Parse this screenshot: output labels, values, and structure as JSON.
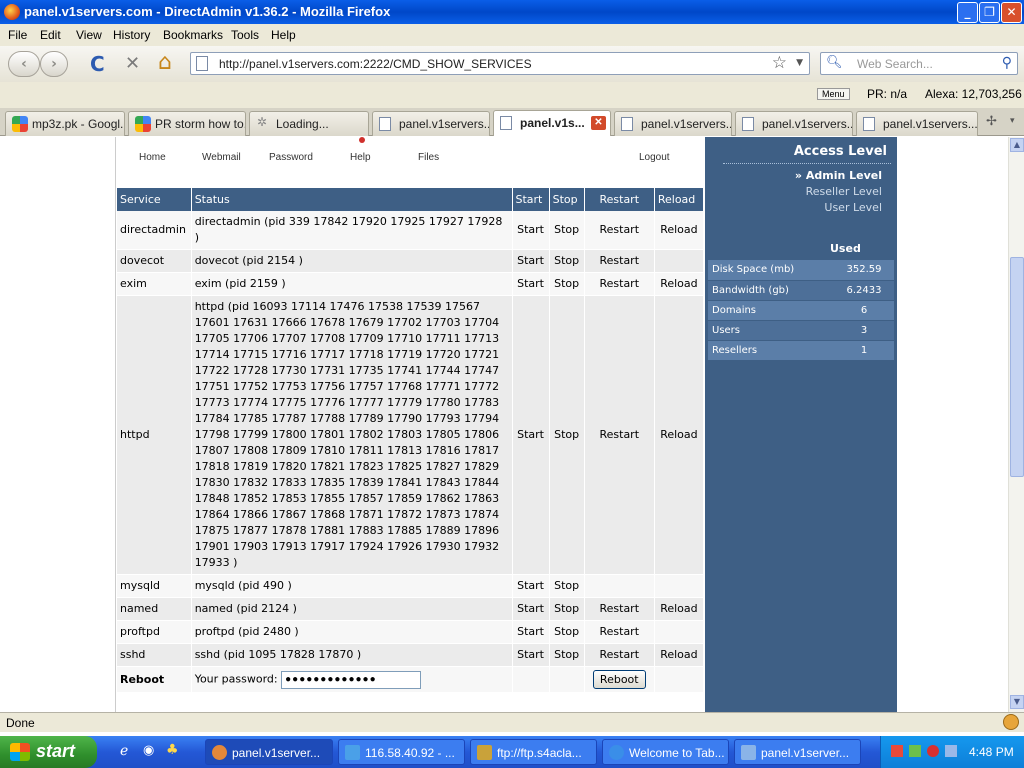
{
  "window": {
    "title": "panel.v1servers.com - DirectAdmin v1.36.2 - Mozilla Firefox",
    "minimize": "_",
    "maximize": "❐",
    "close": "✕"
  },
  "menu": [
    "File",
    "Edit",
    "View",
    "History",
    "Bookmarks",
    "Tools",
    "Help"
  ],
  "nav": {
    "url": "http://panel.v1servers.com:2222/CMD_SHOW_SERVICES",
    "search_placeholder": "Web Search...",
    "back": "‹",
    "forward": "›",
    "reload": "C",
    "stop": "✕",
    "home": "⌂",
    "star": "☆"
  },
  "statusline": {
    "menu": "Menu",
    "pr": "PR: n/a",
    "alexa": "Alexa: 12,703,256"
  },
  "tabs": [
    "mp3z.pk - Googl...",
    "PR storm how to...",
    "Loading...",
    "panel.v1servers...",
    "panel.v1s...",
    "panel.v1servers...",
    "panel.v1servers...",
    "panel.v1servers..."
  ],
  "toolbar_icons": [
    "Home",
    "Webmail",
    "Password",
    "Help",
    "Files",
    "Logout"
  ],
  "services": {
    "headers": [
      "Service",
      "Status",
      "Start",
      "Stop",
      "Restart",
      "Reload"
    ],
    "rows": [
      {
        "service": "directadmin",
        "status": "directadmin (pid 339 17842 17920 17925 17927 17928 )",
        "start": "Start",
        "stop": "Stop",
        "restart": "Restart",
        "reload": "Reload"
      },
      {
        "service": "dovecot",
        "status": "dovecot (pid 2154 )",
        "start": "Start",
        "stop": "Stop",
        "restart": "Restart",
        "reload": ""
      },
      {
        "service": "exim",
        "status": "exim (pid 2159 )",
        "start": "Start",
        "stop": "Stop",
        "restart": "Restart",
        "reload": "Reload"
      },
      {
        "service": "httpd",
        "status": "httpd (pid 16093 17114 17476 17538 17539 17567 17601 17631 17666 17678 17679 17702 17703 17704 17705 17706 17707 17708 17709 17710 17711 17713 17714 17715 17716 17717 17718 17719 17720 17721 17722 17728 17730 17731 17735 17741 17744 17747 17751 17752 17753 17756 17757 17768 17771 17772 17773 17774 17775 17776 17777 17779 17780 17783 17784 17785 17787 17788 17789 17790 17793 17794 17798 17799 17800 17801 17802 17803 17805 17806 17807 17808 17809 17810 17811 17813 17816 17817 17818 17819 17820 17821 17823 17825 17827 17829 17830 17832 17833 17835 17839 17841 17843 17844 17848 17852 17853 17855 17857 17859 17862 17863 17864 17866 17867 17868 17871 17872 17873 17874 17875 17877 17878 17881 17883 17885 17889 17896 17901 17903 17913 17917 17924 17926 17930 17932 17933 )",
        "start": "Start",
        "stop": "Stop",
        "restart": "Restart",
        "reload": "Reload"
      },
      {
        "service": "mysqld",
        "status": "mysqld (pid 490 )",
        "start": "Start",
        "stop": "Stop",
        "restart": "",
        "reload": ""
      },
      {
        "service": "named",
        "status": "named (pid 2124 )",
        "start": "Start",
        "stop": "Stop",
        "restart": "Restart",
        "reload": "Reload"
      },
      {
        "service": "proftpd",
        "status": "proftpd (pid 2480 )",
        "start": "Start",
        "stop": "Stop",
        "restart": "Restart",
        "reload": ""
      },
      {
        "service": "sshd",
        "status": "sshd (pid 1095 17828 17870 )",
        "start": "Start",
        "stop": "Stop",
        "restart": "Restart",
        "reload": "Reload"
      }
    ],
    "reboot": {
      "label": "Reboot",
      "password_label": "Your password:",
      "password_value": "●●●●●●●●●●●●●",
      "button": "Reboot"
    }
  },
  "sidebar": {
    "access_level": "Access Level",
    "levels": [
      "» Admin Level",
      "Reseller Level",
      "User Level"
    ],
    "used_header": "Used",
    "usage": [
      {
        "label": "Disk Space (mb)",
        "value": "352.59"
      },
      {
        "label": "Bandwidth (gb)",
        "value": "6.2433"
      },
      {
        "label": "Domains",
        "value": "6"
      },
      {
        "label": "Users",
        "value": "3"
      },
      {
        "label": "Resellers",
        "value": "1"
      }
    ]
  },
  "status": "Done",
  "taskbar": {
    "start": "start",
    "tasks": [
      "panel.v1server...",
      "116.58.40.92 - ...",
      "ftp://ftp.s4acla...",
      "Welcome to Tab...",
      "panel.v1server..."
    ],
    "clock": "4:48 PM"
  },
  "colors": {
    "header_blue": "#3e5f85",
    "titlebar": "#0a5ee8",
    "taskbar": "#2458d6",
    "start_green": "#2f8f2c"
  }
}
